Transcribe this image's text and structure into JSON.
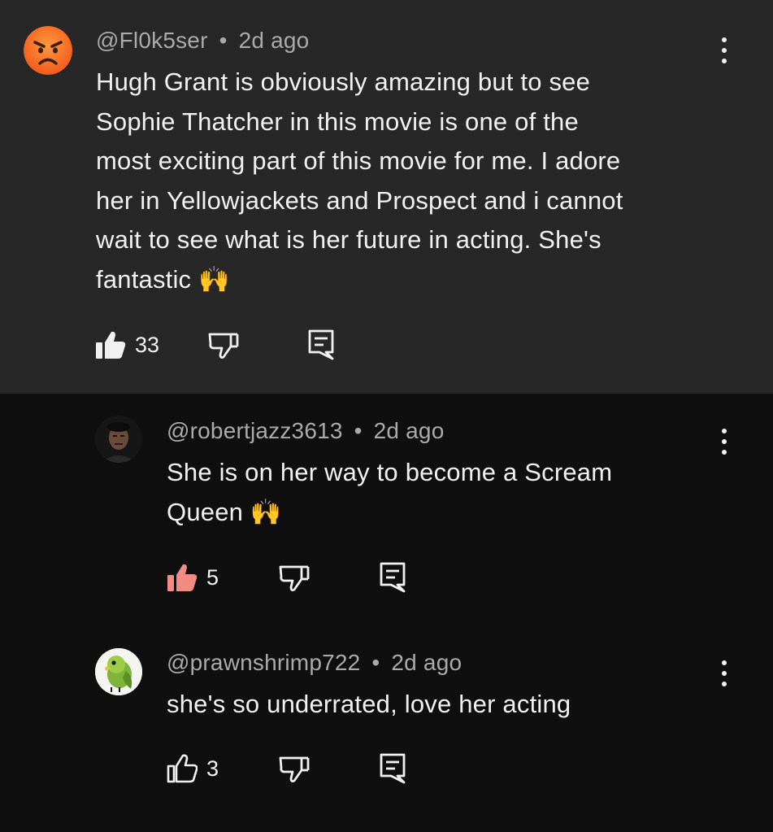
{
  "comments": [
    {
      "handle": "@Fl0k5ser",
      "separator": "•",
      "time": "2d ago",
      "lines": [
        "Hugh Grant is obviously amazing but to see",
        "Sophie Thatcher in this movie is one of the",
        "most exciting part of this movie for me. I adore",
        "her in Yellowjackets and Prospect and i cannot",
        "wait to see what is her future in acting. She's",
        "fantastic 🙌"
      ],
      "likes": "33",
      "avatar_icon": "angry-face-icon",
      "highlighted": true
    },
    {
      "handle": "@robertjazz3613",
      "separator": "•",
      "time": "2d ago",
      "lines": [
        "She is on her way to become a Scream",
        "Queen 🙌"
      ],
      "likes": "5",
      "like_color": "#f28b82",
      "avatar_icon": "dark-portrait-icon"
    },
    {
      "handle": "@prawnshrimp722",
      "separator": "•",
      "time": "2d ago",
      "lines": [
        "she's so underrated, love her acting"
      ],
      "likes": "3",
      "avatar_icon": "green-parrot-icon"
    }
  ],
  "colors": {
    "background": "#0f0f0f",
    "highlight_background": "#272727",
    "meta_text": "#aaaaaa",
    "text": "#f1f1f1"
  }
}
